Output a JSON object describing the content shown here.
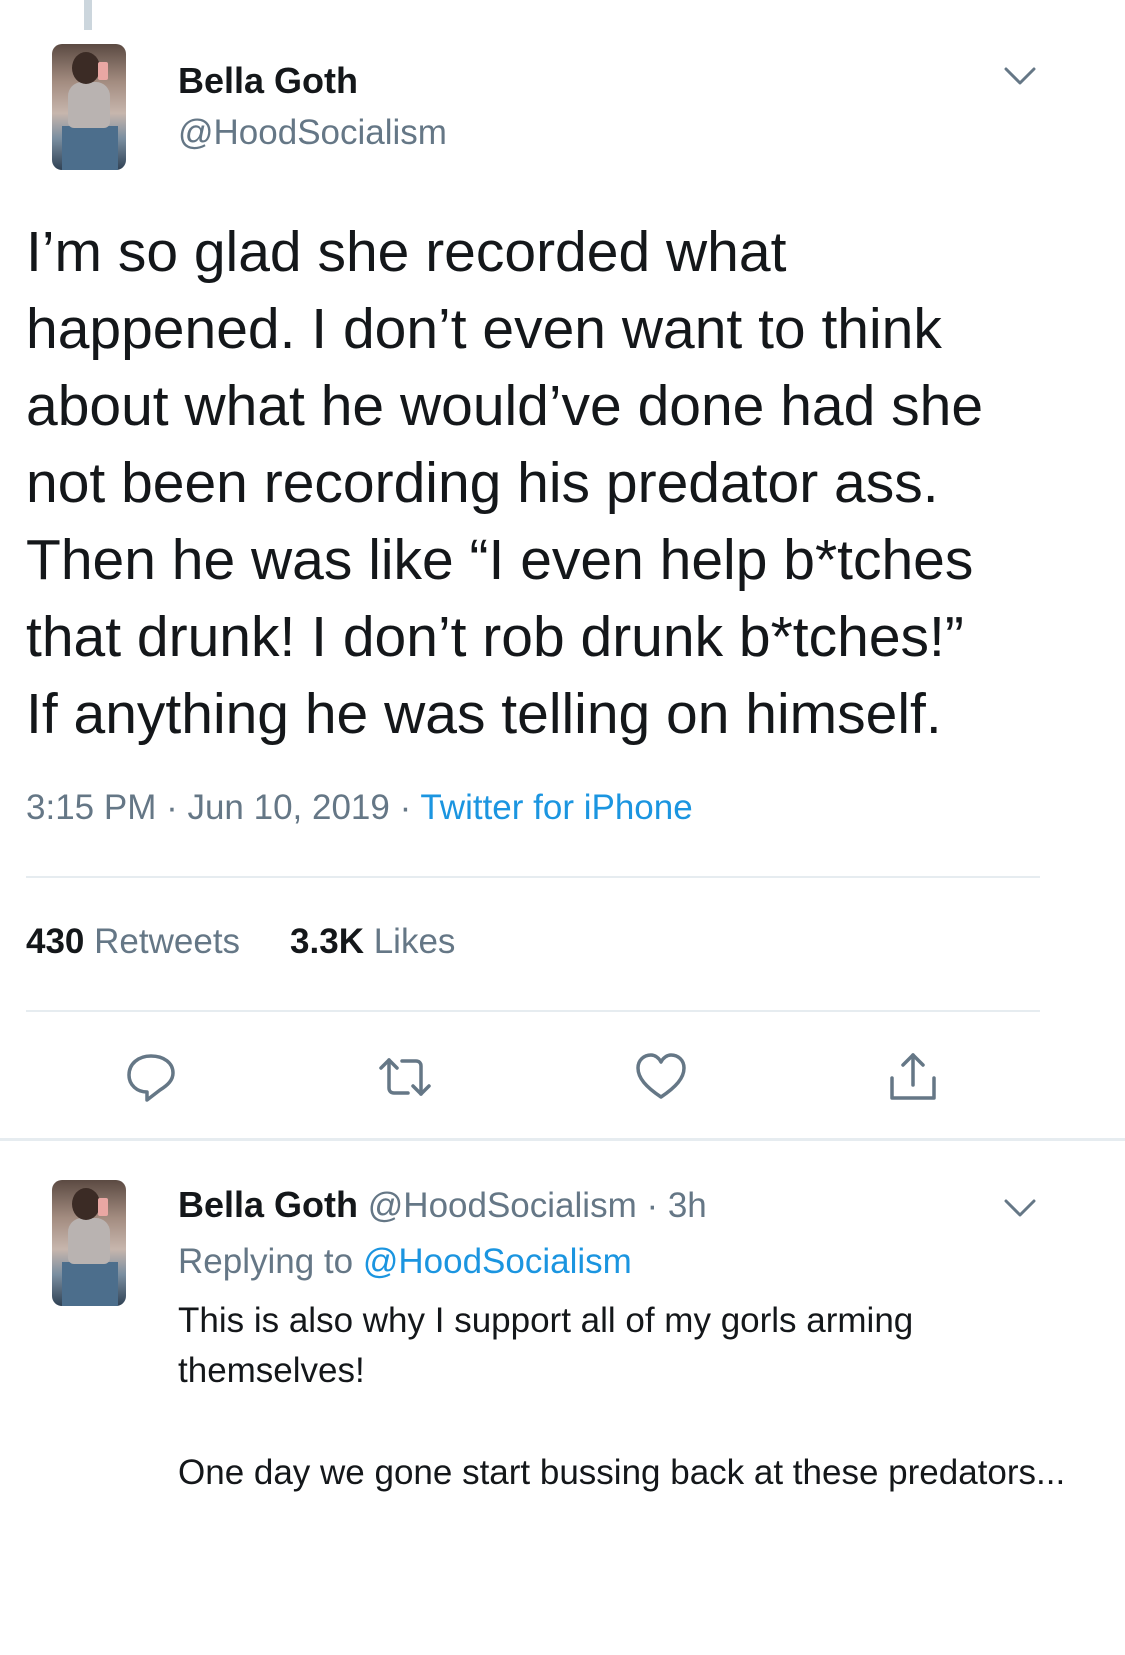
{
  "tweet": {
    "author_name": "Bella Goth",
    "author_handle": "@HoodSocialism",
    "text_lines": [
      "I’m so glad she recorded what",
      "happened. I don’t even want to think",
      "about what he would’ve done had she",
      "not been recording his predator ass.",
      "Then he was like “I even help b*tches",
      "that drunk! I don’t rob drunk b*tches!”",
      "If anything he was telling on himself."
    ],
    "time": "3:15 PM",
    "separator": " · ",
    "date": "Jun 10, 2019",
    "source": "Twitter for iPhone",
    "retweets_count": "430",
    "retweets_label": "Retweets",
    "likes_count": "3.3K",
    "likes_label": "Likes"
  },
  "actions": {
    "icons": [
      "reply-icon",
      "retweet-icon",
      "like-icon",
      "share-icon"
    ]
  },
  "reply": {
    "author_name": "Bella Goth",
    "author_handle": "@HoodSocialism",
    "separator": " · ",
    "age": "3h",
    "replying_prefix": "Replying to ",
    "replying_to": "@HoodSocialism",
    "paragraph1": "This is also why I support all of my gorls arming themselves!",
    "paragraph2": "One day we gone start bussing back at these predators..."
  },
  "colors": {
    "text": "#14171a",
    "secondary": "#657786",
    "link": "#1b95e0",
    "divider": "#e6ecf0",
    "icon": "#657786"
  }
}
